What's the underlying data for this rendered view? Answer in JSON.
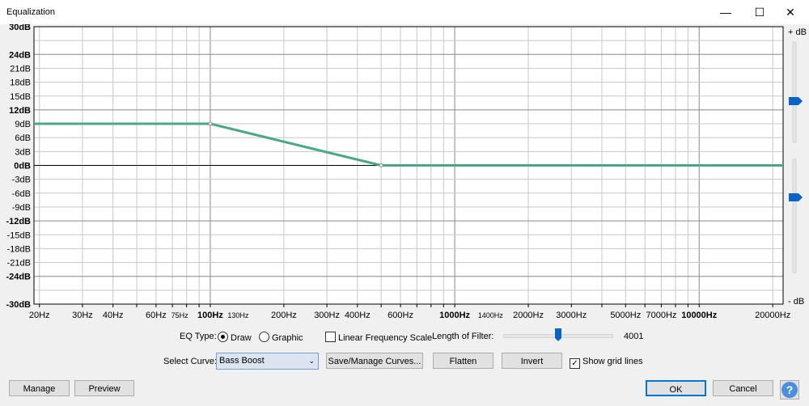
{
  "window": {
    "title": "Equalization",
    "minimize": "—",
    "maximize": "☐",
    "close": "✕"
  },
  "chart_data": {
    "type": "line",
    "xscale": "log",
    "xlim": [
      19,
      22050
    ],
    "ylim": [
      -30,
      30
    ],
    "y_ticks": [
      {
        "v": 30,
        "l": "30dB",
        "b": true
      },
      {
        "v": 24,
        "l": "24dB",
        "b": true
      },
      {
        "v": 21,
        "l": "21dB"
      },
      {
        "v": 18,
        "l": "18dB"
      },
      {
        "v": 15,
        "l": "15dB"
      },
      {
        "v": 12,
        "l": "12dB",
        "b": true
      },
      {
        "v": 9,
        "l": "9dB"
      },
      {
        "v": 6,
        "l": "6dB"
      },
      {
        "v": 3,
        "l": "3dB"
      },
      {
        "v": 0,
        "l": "0dB",
        "b": true
      },
      {
        "v": -3,
        "l": "-3dB"
      },
      {
        "v": -6,
        "l": "-6dB"
      },
      {
        "v": -9,
        "l": "-9dB"
      },
      {
        "v": -12,
        "l": "-12dB",
        "b": true
      },
      {
        "v": -15,
        "l": "-15dB"
      },
      {
        "v": -18,
        "l": "-18dB"
      },
      {
        "v": -21,
        "l": "-21dB"
      },
      {
        "v": -24,
        "l": "-24dB",
        "b": true
      },
      {
        "v": -30,
        "l": "-30dB",
        "b": true
      }
    ],
    "x_ticks": [
      {
        "v": 20,
        "l": "20Hz"
      },
      {
        "v": 30,
        "l": "30Hz"
      },
      {
        "v": 40,
        "l": "40Hz"
      },
      {
        "v": 60,
        "l": "60Hz"
      },
      {
        "v": 75,
        "l": "75Hz",
        "s": true
      },
      {
        "v": 100,
        "l": "100Hz",
        "b": true
      },
      {
        "v": 130,
        "l": "130Hz",
        "s": true
      },
      {
        "v": 200,
        "l": "200Hz"
      },
      {
        "v": 300,
        "l": "300Hz"
      },
      {
        "v": 400,
        "l": "400Hz"
      },
      {
        "v": 600,
        "l": "600Hz"
      },
      {
        "v": 1000,
        "l": "1000Hz",
        "b": true
      },
      {
        "v": 1400,
        "l": "1400Hz",
        "s": true
      },
      {
        "v": 2000,
        "l": "2000Hz"
      },
      {
        "v": 3000,
        "l": "3000Hz"
      },
      {
        "v": 5000,
        "l": "5000Hz"
      },
      {
        "v": 7000,
        "l": "7000Hz"
      },
      {
        "v": 10000,
        "l": "10000Hz",
        "b": true
      },
      {
        "v": 20000,
        "l": "20000Hz"
      }
    ],
    "series": [
      {
        "name": "Bass Boost",
        "color": "#4aa88a",
        "points": [
          [
            19,
            9
          ],
          [
            100,
            9
          ],
          [
            500,
            0
          ],
          [
            22050,
            0
          ]
        ]
      }
    ],
    "grid": true,
    "right_labels": {
      "plus": "+ dB",
      "minus": "- dB"
    }
  },
  "controls": {
    "eq_type_label": "EQ Type:",
    "draw": "Draw",
    "graphic": "Graphic",
    "linear_scale": "Linear Frequency Scale",
    "filter_length_label": "Length of Filter:",
    "filter_length": "4001",
    "filter_fraction": 0.5,
    "select_curve_label": "Select Curve:",
    "curve": "Bass Boost",
    "save_manage": "Save/Manage Curves...",
    "flatten": "Flatten",
    "invert": "Invert",
    "show_grid": "Show grid lines",
    "manage": "Manage",
    "preview": "Preview",
    "ok": "OK",
    "cancel": "Cancel",
    "help": "?"
  }
}
